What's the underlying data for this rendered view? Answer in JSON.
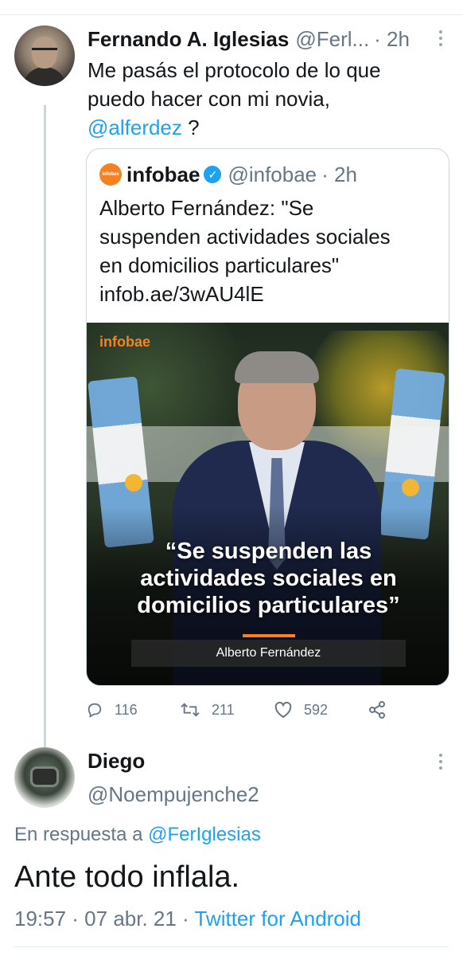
{
  "tweet1": {
    "name": "Fernando A. Iglesias",
    "handle": "@Ferl...",
    "time": "· 2h",
    "text_line1": "Me pasás el protocolo de lo que",
    "text_line2": "puedo hacer con mi novia,",
    "mention": "@alferdez",
    "text_after_mention": " ?",
    "quote": {
      "logo_text": "infobae",
      "name": "infobae",
      "handle": "@infobae",
      "time": "· 2h",
      "text_line1": "Alberto Fernández: \"Se",
      "text_line2": "suspenden actividades sociales",
      "text_line3": "en domicilios particulares\"",
      "text_line4": "infob.ae/3wAU4lE",
      "image": {
        "brand": "infobae",
        "quote_line1": "“Se suspenden las",
        "quote_line2": "actividades sociales en",
        "quote_line3": "domicilios particulares”",
        "nameplate": "Alberto Fernández"
      }
    },
    "actions": {
      "replies": "116",
      "retweets": "211",
      "likes": "592"
    }
  },
  "tweet2": {
    "name": "Diego",
    "handle": "@Noempujenche2",
    "reply_prefix": "En respuesta a ",
    "reply_mention": "@FerIglesias",
    "text": "Ante todo inflala.",
    "meta": "19:57 · 07 abr. 21 · ",
    "source": "Twitter for Android"
  },
  "colors": {
    "link": "#1da1f2",
    "secondary": "#657786",
    "infobae_orange": "#f58220"
  },
  "icons": [
    "more-vertical-icon",
    "verified-badge-icon",
    "reply-icon",
    "retweet-icon",
    "like-icon",
    "share-icon"
  ]
}
